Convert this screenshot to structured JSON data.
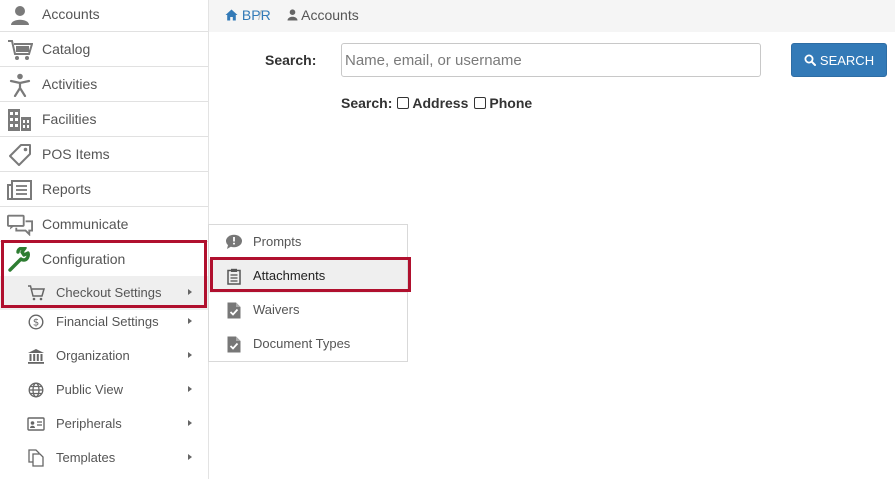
{
  "sidebar": {
    "items": [
      {
        "label": "Accounts",
        "icon": "user-icon"
      },
      {
        "label": "Catalog",
        "icon": "cart-icon"
      },
      {
        "label": "Activities",
        "icon": "person-icon"
      },
      {
        "label": "Facilities",
        "icon": "building-icon"
      },
      {
        "label": "POS Items",
        "icon": "tag-icon"
      },
      {
        "label": "Reports",
        "icon": "reports-icon"
      },
      {
        "label": "Communicate",
        "icon": "chat-icon"
      },
      {
        "label": "Configuration",
        "icon": "wrench-icon"
      }
    ],
    "subitems": [
      {
        "label": "Checkout Settings",
        "icon": "cart-icon"
      },
      {
        "label": "Financial Settings",
        "icon": "dollar-icon"
      },
      {
        "label": "Organization",
        "icon": "bank-icon"
      },
      {
        "label": "Public View",
        "icon": "globe-icon"
      },
      {
        "label": "Peripherals",
        "icon": "id-card-icon"
      },
      {
        "label": "Templates",
        "icon": "copy-icon"
      }
    ]
  },
  "breadcrumb": {
    "home": "BPR",
    "separator": "/",
    "current": "Accounts"
  },
  "search": {
    "label": "Search:",
    "placeholder": "Name, email, or username",
    "value": "",
    "button_label": "SEARCH",
    "options_label": "Search:",
    "options": [
      {
        "label": "Address",
        "checked": false
      },
      {
        "label": "Phone",
        "checked": false
      }
    ]
  },
  "flyout": {
    "items": [
      {
        "label": "Prompts",
        "icon": "comment-icon"
      },
      {
        "label": "Attachments",
        "icon": "clipboard-icon"
      },
      {
        "label": "Waivers",
        "icon": "doc-check-icon"
      },
      {
        "label": "Document Types",
        "icon": "doc-check-icon"
      }
    ]
  },
  "colors": {
    "accent": "#337ab7",
    "highlight": "#b0102e",
    "wrench": "#2e7d32"
  }
}
